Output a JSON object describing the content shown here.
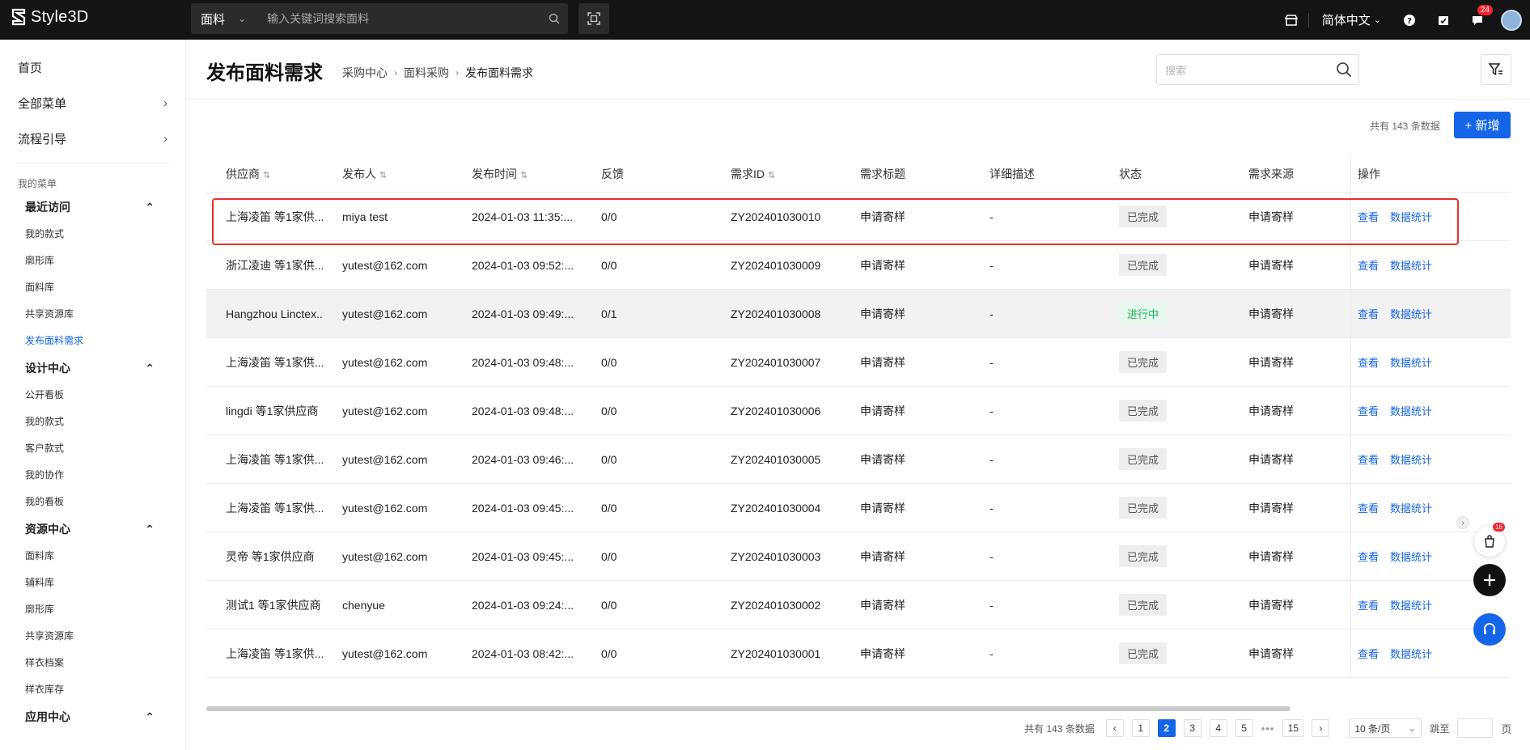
{
  "topbar": {
    "logo_text": "Style3D",
    "search_category": "面料",
    "search_placeholder": "输入关键词搜索面料",
    "language": "简体中文",
    "notification_count": "24"
  },
  "sidebar": {
    "top_items": [
      {
        "label": "首页"
      },
      {
        "label": "全部菜单"
      },
      {
        "label": "流程引导"
      }
    ],
    "section_label": "我的菜单",
    "groups": [
      {
        "title": "最近访问",
        "items": [
          "我的款式",
          "廓形库",
          "面料库",
          "共享资源库",
          "发布面料需求"
        ]
      },
      {
        "title": "设计中心",
        "items": [
          "公开看板",
          "我的款式",
          "客户款式",
          "我的协作",
          "我的看板"
        ]
      },
      {
        "title": "资源中心",
        "items": [
          "面料库",
          "辅料库",
          "廓形库",
          "共享资源库",
          "样衣档案",
          "样衣库存"
        ]
      },
      {
        "title": "应用中心",
        "items": []
      }
    ]
  },
  "header": {
    "title": "发布面料需求",
    "breadcrumb": [
      "采购中心",
      "面料采购",
      "发布面料需求"
    ],
    "search_placeholder": "搜索"
  },
  "toolbar": {
    "total_text": "共有 143 条数据",
    "add_label": "+ 新增"
  },
  "table": {
    "columns": [
      "供应商",
      "发布人",
      "发布时间",
      "反馈",
      "需求ID",
      "需求标题",
      "详细描述",
      "状态",
      "需求来源",
      "操作"
    ],
    "rows": [
      {
        "supplier": "上海凌笛 等1家供...",
        "publisher": "miya test",
        "time": "2024-01-03 11:35:...",
        "feedback": "0/0",
        "id": "ZY202401030010",
        "title": "申请寄样",
        "desc": "-",
        "status": "已完成",
        "source": "申请寄样"
      },
      {
        "supplier": "浙江凌迪 等1家供...",
        "publisher": "yutest@162.com",
        "time": "2024-01-03 09:52:...",
        "feedback": "0/0",
        "id": "ZY202401030009",
        "title": "申请寄样",
        "desc": "-",
        "status": "已完成",
        "source": "申请寄样"
      },
      {
        "supplier": "Hangzhou Linctex...",
        "publisher": "yutest@162.com",
        "time": "2024-01-03 09:49:...",
        "feedback": "0/1",
        "id": "ZY202401030008",
        "title": "申请寄样",
        "desc": "-",
        "status": "进行中",
        "source": "申请寄样"
      },
      {
        "supplier": "上海凌笛 等1家供...",
        "publisher": "yutest@162.com",
        "time": "2024-01-03 09:48:...",
        "feedback": "0/0",
        "id": "ZY202401030007",
        "title": "申请寄样",
        "desc": "-",
        "status": "已完成",
        "source": "申请寄样"
      },
      {
        "supplier": "lingdi 等1家供应商",
        "publisher": "yutest@162.com",
        "time": "2024-01-03 09:48:...",
        "feedback": "0/0",
        "id": "ZY202401030006",
        "title": "申请寄样",
        "desc": "-",
        "status": "已完成",
        "source": "申请寄样"
      },
      {
        "supplier": "上海凌笛 等1家供...",
        "publisher": "yutest@162.com",
        "time": "2024-01-03 09:46:...",
        "feedback": "0/0",
        "id": "ZY202401030005",
        "title": "申请寄样",
        "desc": "-",
        "status": "已完成",
        "source": "申请寄样"
      },
      {
        "supplier": "上海凌笛 等1家供...",
        "publisher": "yutest@162.com",
        "time": "2024-01-03 09:45:...",
        "feedback": "0/0",
        "id": "ZY202401030004",
        "title": "申请寄样",
        "desc": "-",
        "status": "已完成",
        "source": "申请寄样"
      },
      {
        "supplier": "灵帝 等1家供应商",
        "publisher": "yutest@162.com",
        "time": "2024-01-03 09:45:...",
        "feedback": "0/0",
        "id": "ZY202401030003",
        "title": "申请寄样",
        "desc": "-",
        "status": "已完成",
        "source": "申请寄样"
      },
      {
        "supplier": "测试1 等1家供应商",
        "publisher": "chenyue",
        "time": "2024-01-03 09:24:...",
        "feedback": "0/0",
        "id": "ZY202401030002",
        "title": "申请寄样",
        "desc": "-",
        "status": "已完成",
        "source": "申请寄样"
      },
      {
        "supplier": "上海凌笛 等1家供...",
        "publisher": "yutest@162.com",
        "time": "2024-01-03 08:42:...",
        "feedback": "0/0",
        "id": "ZY202401030001",
        "title": "申请寄样",
        "desc": "-",
        "status": "已完成",
        "source": "申请寄样"
      }
    ],
    "actions": [
      "查看",
      "数据统计"
    ],
    "highlighted_row_index": 2
  },
  "pagination": {
    "total_text": "共有 143 条数据",
    "pages": [
      "1",
      "2",
      "3",
      "4",
      "5",
      "•••",
      "15"
    ],
    "current_page": "2",
    "page_size": "10 条/页",
    "jump_label": "跳至",
    "page_suffix": "页"
  },
  "floating": {
    "cart_count": "16"
  },
  "colors": {
    "accent": "#1565e8",
    "topbar": "#141414",
    "status_done_bg": "#eeeeee",
    "status_progress_text": "#17b45c",
    "annotation_red": "#e8302a"
  }
}
